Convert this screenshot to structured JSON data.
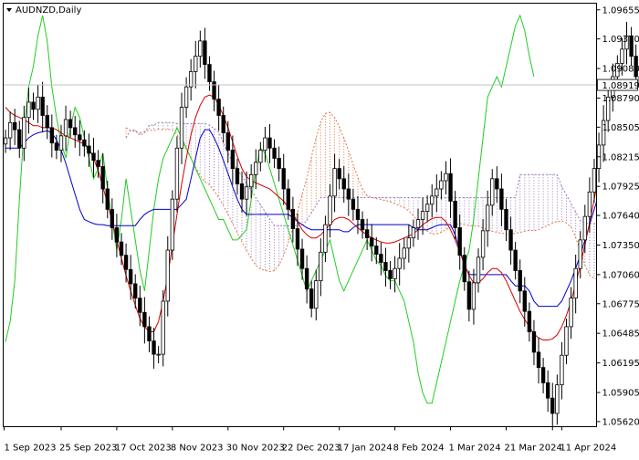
{
  "chart_data": {
    "type": "candlestick",
    "symbol_label": "AUDNZD,Daily",
    "y_ticks": [
      "1.09655",
      "1.09370",
      "1.09080",
      "1.08790",
      "1.08505",
      "1.08215",
      "1.07925",
      "1.07640",
      "1.07350",
      "1.07060",
      "1.06775",
      "1.06485",
      "1.06195",
      "1.05905",
      "1.05620"
    ],
    "x_ticks": [
      "1 Sep 2023",
      "25 Sep 2023",
      "17 Oct 2023",
      "8 Nov 2023",
      "30 Nov 2023",
      "22 Dec 2023",
      "17 Jan 2024",
      "8 Feb 2024",
      "1 Mar 2024",
      "21 Mar 2024",
      "11 Apr 2024"
    ],
    "ylim": [
      1.0557,
      1.0972
    ],
    "current_price": 1.08919,
    "current_price_label": "1.08919",
    "grid": false,
    "colors": {
      "candles": "#000000",
      "tenkan_sen": "#d40000",
      "kijun_sen": "#0000c8",
      "chikou_span": "#22cc22",
      "cloud_bullish": "#e07a4a",
      "cloud_bearish": "#9a7ac0",
      "price_line": "#c0c0c0",
      "background": "#ffffff"
    },
    "close": [
      1.084,
      1.0855,
      1.0848,
      1.083,
      1.086,
      1.0875,
      1.0868,
      1.088,
      1.0862,
      1.085,
      1.0835,
      1.0828,
      1.0842,
      1.0858,
      1.085,
      1.0843,
      1.0838,
      1.0832,
      1.0825,
      1.0818,
      1.0812,
      1.079,
      1.077,
      1.0752,
      1.0738,
      1.0725,
      1.0711,
      1.0697,
      1.0683,
      1.0669,
      1.0655,
      1.0641,
      1.0628,
      1.0628,
      1.068,
      1.073,
      1.078,
      1.083,
      1.087,
      1.089,
      1.0905,
      1.092,
      1.0935,
      1.0912,
      1.0895,
      1.0878,
      1.0862,
      1.0845,
      1.0828,
      1.081,
      1.0795,
      1.078,
      1.0792,
      1.0804,
      1.0816,
      1.0828,
      1.084,
      1.083,
      1.082,
      1.081,
      1.079,
      1.077,
      1.0751,
      1.0731,
      1.0712,
      1.0692,
      1.0673,
      1.07,
      1.0728,
      1.0755,
      1.0783,
      1.081,
      1.08,
      1.079,
      1.078,
      1.077,
      1.076,
      1.075,
      1.0742,
      1.0734,
      1.0726,
      1.0718,
      1.071,
      1.0702,
      1.0712,
      1.0722,
      1.0732,
      1.0742,
      1.0752,
      1.076,
      1.0768,
      1.0775,
      1.0783,
      1.079,
      1.0798,
      1.0805,
      1.0778,
      1.0752,
      1.0725,
      1.0699,
      1.0672,
      1.0698,
      1.0723,
      1.0749,
      1.0774,
      1.08,
      1.079,
      1.077,
      1.075,
      1.073,
      1.071,
      1.069,
      1.067,
      1.065,
      1.063,
      1.0615,
      1.06,
      1.0585,
      1.057,
      1.0598,
      1.0627,
      1.0655,
      1.0683,
      1.0712,
      1.074,
      1.0763,
      1.0787,
      1.081,
      1.0833,
      1.0857,
      1.088,
      1.09,
      1.0913,
      1.0927,
      1.094,
      1.092,
      1.09,
      1.0892
    ],
    "tenkan_sen": [
      1.087,
      1.0865,
      1.0862,
      1.086,
      1.0858,
      1.0855,
      1.0852,
      1.0852,
      1.085,
      1.085,
      1.085,
      1.0848,
      1.0845,
      1.0842,
      1.084,
      1.0838,
      1.0836,
      1.0834,
      1.083,
      1.082,
      1.0808,
      1.0792,
      1.0776,
      1.0758,
      1.074,
      1.0722,
      1.0705,
      1.069,
      1.0676,
      1.0663,
      1.0655,
      1.065,
      1.065,
      1.066,
      1.068,
      1.0705,
      1.0735,
      1.0765,
      1.0795,
      1.082,
      1.0843,
      1.086,
      1.0872,
      1.088,
      1.0882,
      1.088,
      1.0872,
      1.0862,
      1.085,
      1.0836,
      1.0822,
      1.081,
      1.0802,
      1.0798,
      1.0796,
      1.0794,
      1.0792,
      1.079,
      1.0786,
      1.0782,
      1.0778,
      1.0772,
      1.0765,
      1.0758,
      1.075,
      1.0745,
      1.0742,
      1.0742,
      1.0745,
      1.075,
      1.0755,
      1.076,
      1.0762,
      1.0762,
      1.076,
      1.0756,
      1.0752,
      1.0748,
      1.0745,
      1.0742,
      1.074,
      1.0738,
      1.0737,
      1.0737,
      1.0738,
      1.074,
      1.0742,
      1.0744,
      1.0746,
      1.075,
      1.0755,
      1.0758,
      1.0761,
      1.0762,
      1.0762,
      1.0758,
      1.075,
      1.074,
      1.0728,
      1.0716,
      1.0705,
      1.0698,
      1.0698,
      1.0702,
      1.0708,
      1.0712,
      1.0712,
      1.0708,
      1.07,
      1.069,
      1.068,
      1.067,
      1.0662,
      1.0655,
      1.0648,
      1.0644,
      1.0642,
      1.0642,
      1.0643,
      1.0647,
      1.0655,
      1.0666,
      1.068,
      1.0697,
      1.0715,
      1.0735,
      1.0757,
      1.078,
      1.0803,
      1.0826,
      1.0848,
      1.0868,
      1.0884,
      1.0895,
      1.0902,
      1.0905,
      1.0902,
      1.0898
    ],
    "kijun_sen": [
      1.083,
      1.083,
      1.083,
      1.083,
      1.0835,
      1.084,
      1.0843,
      1.0845,
      1.0846,
      1.0847,
      1.0845,
      1.0838,
      1.0828,
      1.0815,
      1.08,
      1.0785,
      1.077,
      1.076,
      1.0758,
      1.0756,
      1.0755,
      1.0755,
      1.0754,
      1.0754,
      1.0754,
      1.0754,
      1.0754,
      1.0754,
      1.0754,
      1.076,
      1.0765,
      1.0768,
      1.077,
      1.077,
      1.077,
      1.077,
      1.077,
      1.077,
      1.0775,
      1.078,
      1.08,
      1.082,
      1.084,
      1.0848,
      1.0848,
      1.084,
      1.083,
      1.0818,
      1.0805,
      1.0792,
      1.078,
      1.077,
      1.0765,
      1.0765,
      1.0765,
      1.0765,
      1.0765,
      1.0765,
      1.0765,
      1.0765,
      1.0765,
      1.0765,
      1.0762,
      1.0758,
      1.0755,
      1.0752,
      1.075,
      1.075,
      1.075,
      1.075,
      1.075,
      1.075,
      1.075,
      1.0748,
      1.0748,
      1.0752,
      1.0755,
      1.0755,
      1.0755,
      1.0755,
      1.0755,
      1.0755,
      1.0755,
      1.0755,
      1.0755,
      1.0755,
      1.0755,
      1.0755,
      1.0752,
      1.075,
      1.075,
      1.075,
      1.0752,
      1.0754,
      1.0755,
      1.0755,
      1.0755,
      1.0745,
      1.073,
      1.0715,
      1.0706,
      1.0706,
      1.0706,
      1.0706,
      1.0706,
      1.0706,
      1.0706,
      1.0706,
      1.0706,
      1.07,
      1.0695,
      1.0695,
      1.0695,
      1.069,
      1.068,
      1.0675,
      1.0675,
      1.0675,
      1.0675,
      1.0675,
      1.068,
      1.069,
      1.07,
      1.0712,
      1.0725,
      1.074,
      1.0755,
      1.077,
      1.0785,
      1.0795,
      1.0803,
      1.0812,
      1.0822,
      1.0827,
      1.0828,
      1.0828,
      1.0828,
      1.0828
    ],
    "chikou_span": [
      1.064,
      1.066,
      1.07,
      1.078,
      1.085,
      1.089,
      1.091,
      1.094,
      1.096,
      1.0935,
      1.089,
      1.086,
      1.0835,
      1.082,
      1.085,
      1.087,
      1.086,
      1.084,
      1.082,
      1.08,
      1.081,
      1.0825,
      1.079,
      1.076,
      1.073,
      1.076,
      1.08,
      1.077,
      1.074,
      1.071,
      1.069,
      1.073,
      1.077,
      1.08,
      1.082,
      1.083,
      1.084,
      1.085,
      1.084,
      1.083,
      1.082,
      1.081,
      1.08,
      1.079,
      1.078,
      1.077,
      1.076,
      1.076,
      1.075,
      1.074,
      1.074,
      1.0745,
      1.075,
      1.078,
      1.081,
      1.083,
      1.0825,
      1.081,
      1.0795,
      1.078,
      1.0765,
      1.075,
      1.0735,
      1.072,
      1.0705,
      1.069,
      1.07,
      1.071,
      1.072,
      1.073,
      1.074,
      1.072,
      1.07,
      1.069,
      1.07,
      1.071,
      1.072,
      1.073,
      1.074,
      1.073,
      1.072,
      1.0715,
      1.0705,
      1.07,
      1.07,
      1.069,
      1.068,
      1.066,
      1.064,
      1.061,
      1.059,
      1.058,
      1.058,
      1.06,
      1.062,
      1.064,
      1.066,
      1.068,
      1.07,
      1.0715,
      1.073,
      1.076,
      1.08,
      1.084,
      1.088,
      1.089,
      1.09,
      1.089,
      1.091,
      1.093,
      1.095,
      1.096,
      1.0945,
      1.092,
      1.09
    ]
  }
}
